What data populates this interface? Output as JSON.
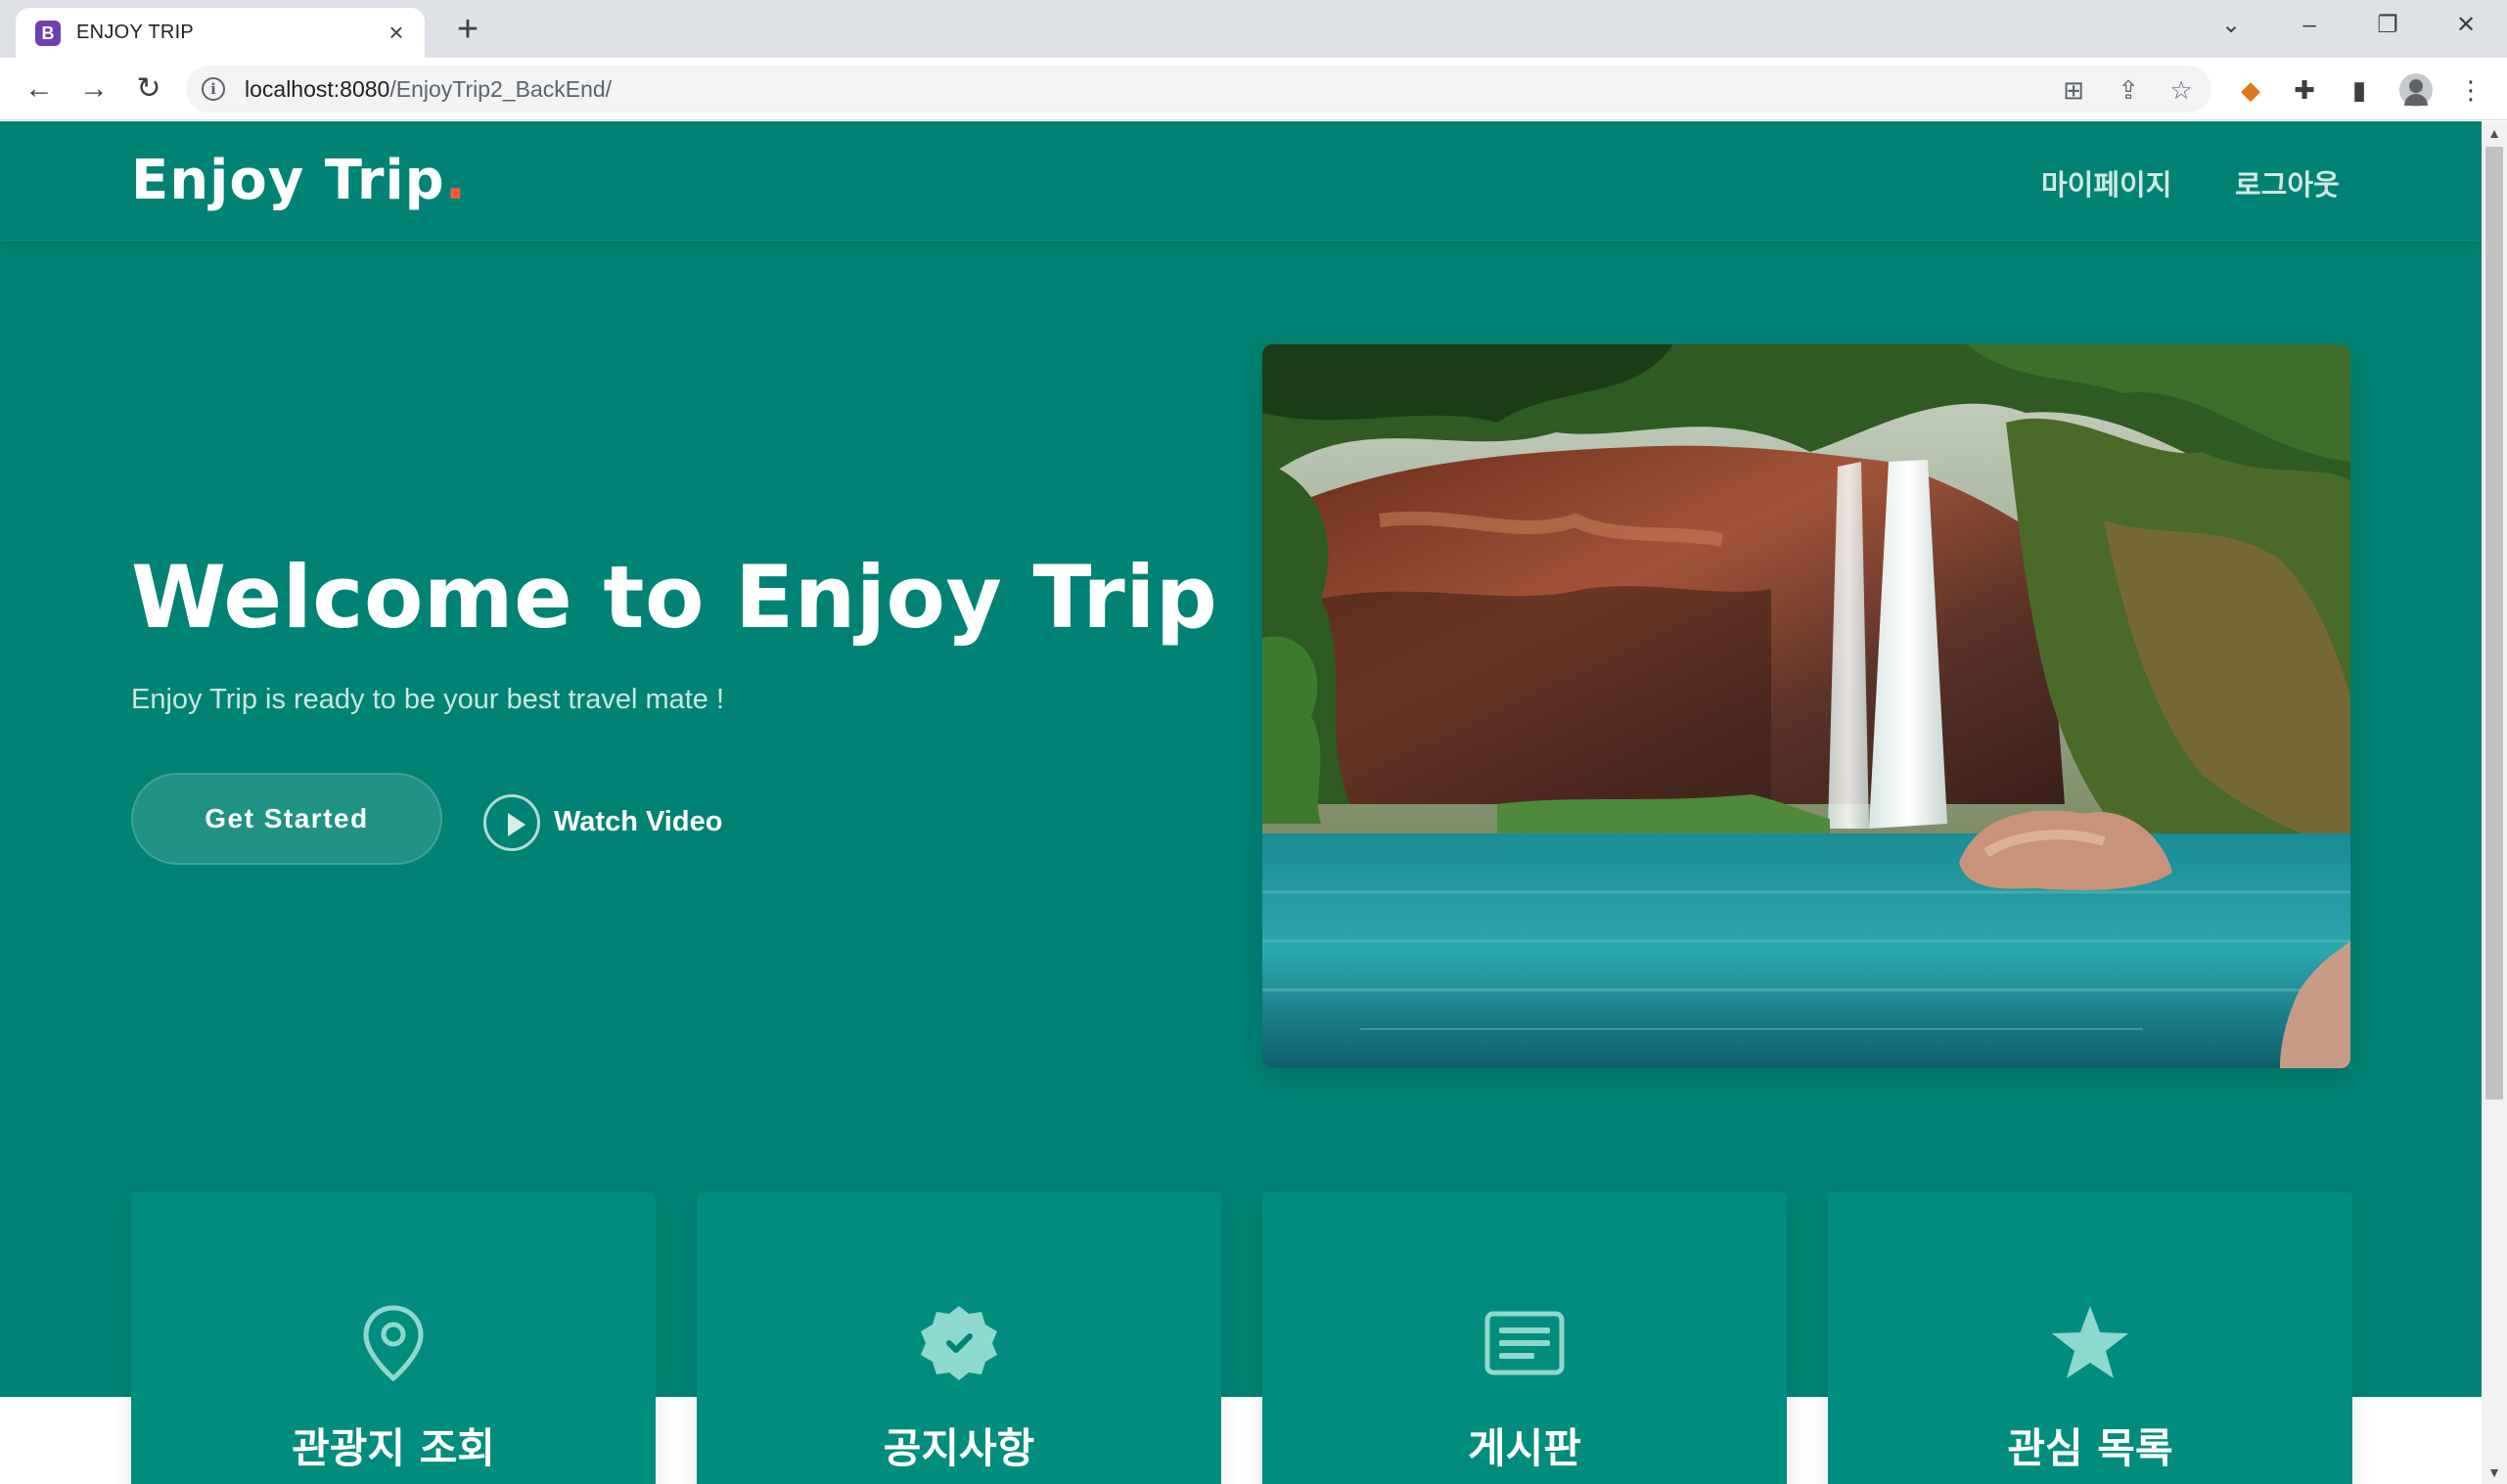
{
  "browser": {
    "tab_title": "ENJOY TRIP",
    "favicon_letter": "B",
    "url_host": "localhost:8080",
    "url_path": "/EnjoyTrip2_BackEnd/"
  },
  "header": {
    "brand": "Enjoy Trip",
    "brand_dot": ".",
    "nav": [
      "마이페이지",
      "로그아웃"
    ]
  },
  "hero": {
    "title": "Welcome to Enjoy Trip",
    "subtitle": "Enjoy Trip is ready to be your best travel mate !",
    "cta_label": "Get Started",
    "video_label": "Watch Video"
  },
  "cards": [
    {
      "title": "관광지 조회",
      "icon": "map-pin-icon"
    },
    {
      "title": "공지사항",
      "icon": "verified-badge-icon"
    },
    {
      "title": "게시판",
      "icon": "board-icon"
    },
    {
      "title": "관심 목록",
      "icon": "star-icon"
    }
  ],
  "colors": {
    "primary": "#008374",
    "card": "#008d7d",
    "accent_dot": "#f85a40"
  }
}
